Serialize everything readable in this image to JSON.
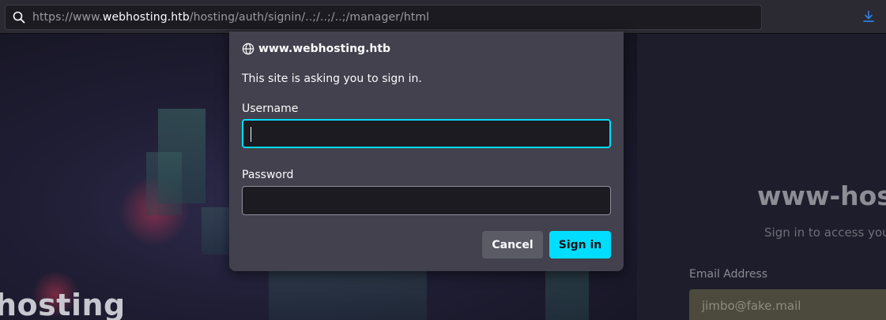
{
  "browser": {
    "url": {
      "prefix": "https://www.",
      "host": "webhosting.htb",
      "path": "/hosting/auth/signin/..;/..;/..;/manager/html"
    },
    "icons": {
      "search": "search-icon",
      "download": "download-icon"
    }
  },
  "background_page": {
    "hero_heading": "hosting",
    "brand_title": "www-hos",
    "brand_subtitle": "Sign in to access your",
    "email_label": "Email Address",
    "email_placeholder": "jimbo@fake.mail"
  },
  "auth_dialog": {
    "origin": "www.webhosting.htb",
    "message": "This site is asking you to sign in.",
    "username_label": "Username",
    "username_value": "",
    "password_label": "Password",
    "password_value": "",
    "cancel_label": "Cancel",
    "signin_label": "Sign in",
    "colors": {
      "accent": "#00ddff",
      "dialog_bg": "#42414d",
      "input_bg": "#1c1b22"
    }
  }
}
